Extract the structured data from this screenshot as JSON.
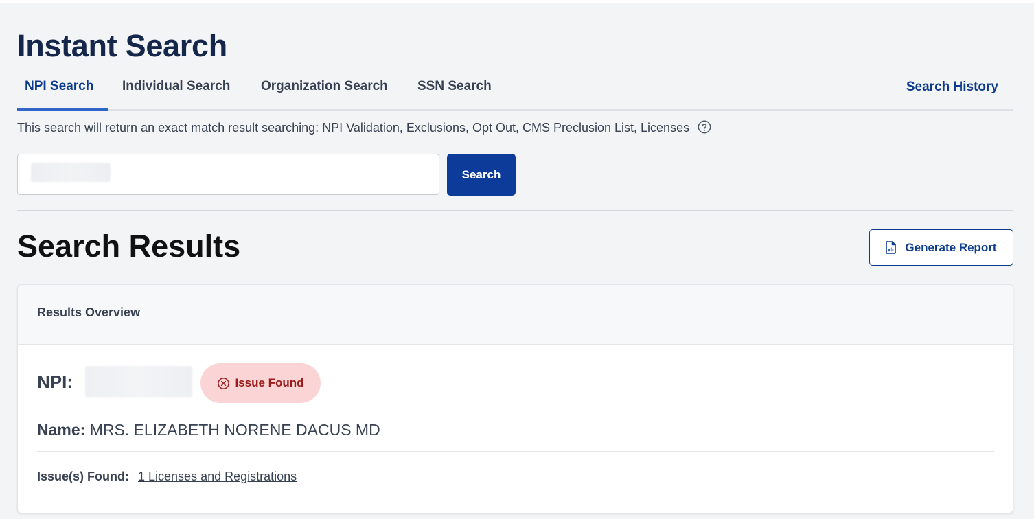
{
  "header": {
    "title": "Instant Search"
  },
  "tabs": [
    {
      "label": "NPI Search",
      "active": true
    },
    {
      "label": "Individual Search",
      "active": false
    },
    {
      "label": "Organization Search",
      "active": false
    },
    {
      "label": "SSN Search",
      "active": false
    }
  ],
  "search_history_label": "Search History",
  "search": {
    "description": "This search will return an exact match result searching: NPI Validation, Exclusions, Opt Out, CMS Preclusion List, Licenses",
    "help_icon": "question-circle-icon",
    "input_value": "",
    "button_label": "Search"
  },
  "results": {
    "title": "Search Results",
    "generate_report_label": "Generate Report",
    "report_icon": "document-chart-icon",
    "overview_title": "Results Overview",
    "npi_label": "NPI:",
    "badge_label": "Issue Found",
    "badge_icon": "x-circle-icon",
    "name_label": "Name:",
    "name_value": "MRS. ELIZABETH NORENE DACUS MD",
    "issues_label": "Issue(s) Found:",
    "issues_link": "1 Licenses and Registrations"
  },
  "colors": {
    "primary": "#0d3b99",
    "title": "#14264a",
    "badge_bg": "#fbd5d5",
    "badge_text": "#9b1c1c",
    "page_bg": "#f3f4f6"
  }
}
